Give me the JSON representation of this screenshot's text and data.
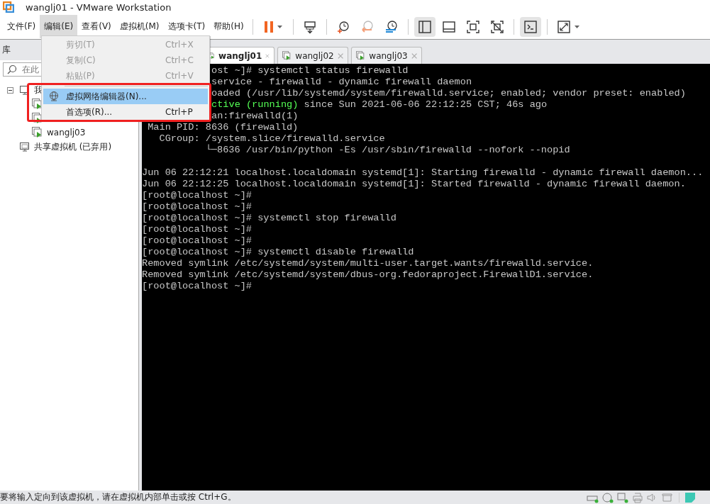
{
  "window": {
    "title": "wanglj01 - VMware Workstation"
  },
  "menubar": [
    {
      "label": "文件(F)",
      "selected": false
    },
    {
      "label": "编辑(E)",
      "selected": true
    },
    {
      "label": "查看(V)",
      "selected": false
    },
    {
      "label": "虚拟机(M)",
      "selected": false
    },
    {
      "label": "选项卡(T)",
      "selected": false
    },
    {
      "label": "帮助(H)",
      "selected": false
    }
  ],
  "toolbar": [
    {
      "kind": "sep"
    },
    {
      "kind": "pause",
      "on": false
    },
    {
      "kind": "sep"
    },
    {
      "kind": "sendkeys",
      "on": false
    },
    {
      "kind": "sep"
    },
    {
      "kind": "snapshot",
      "on": false
    },
    {
      "kind": "revert",
      "on": false
    },
    {
      "kind": "manage",
      "on": false
    },
    {
      "kind": "sep"
    },
    {
      "kind": "library",
      "on": true
    },
    {
      "kind": "thumbs",
      "on": false
    },
    {
      "kind": "fullscreen",
      "on": false
    },
    {
      "kind": "unity",
      "on": false
    },
    {
      "kind": "sep"
    },
    {
      "kind": "console",
      "on": true
    },
    {
      "kind": "sep"
    },
    {
      "kind": "stretch",
      "on": false
    }
  ],
  "library": {
    "title": "库",
    "search": {
      "placeholder": "在此"
    },
    "tree": [
      {
        "label": "我",
        "expanded": true,
        "kind": "computer",
        "children": [
          {
            "kind": "vm"
          },
          {
            "kind": "vm"
          },
          {
            "kind": "vm",
            "label": "wanglj03"
          }
        ]
      },
      {
        "label": "共享虚拟机 (已弃用)",
        "kind": "shared"
      }
    ]
  },
  "tabs": [
    {
      "label": "wanglj01",
      "selected": true
    },
    {
      "label": "wanglj02",
      "selected": false
    },
    {
      "label": "wanglj03",
      "selected": false
    }
  ],
  "edit_menu": {
    "items": [
      {
        "kind": "item",
        "label": "剪切(T)",
        "shortcut": "Ctrl+X",
        "disabled": true,
        "selected": false
      },
      {
        "kind": "item",
        "label": "复制(C)",
        "shortcut": "Ctrl+C",
        "disabled": true,
        "selected": false
      },
      {
        "kind": "item",
        "label": "粘贴(P)",
        "shortcut": "Ctrl+V",
        "disabled": true,
        "selected": false
      },
      {
        "kind": "separator"
      },
      {
        "kind": "globe",
        "label": "虚拟网络编辑器(N)...",
        "disabled": false,
        "selected": true
      },
      {
        "kind": "item",
        "label": "首选项(R)...",
        "shortcut": "Ctrl+P",
        "disabled": false,
        "selected": false
      }
    ]
  },
  "terminal": {
    "lines": [
      {
        "kind": "covered",
        "segments": [
          {
            "text": "ost ~]# systemctl status firewalld"
          }
        ]
      },
      {
        "kind": "covered",
        "segments": [
          {
            "text": "service - firewalld - dynamic firewall daemon"
          }
        ]
      },
      {
        "kind": "covered",
        "segments": [
          {
            "text": "oaded (/usr/lib/systemd/system/firewalld.service; enabled; vendor preset: enabled)"
          }
        ]
      },
      {
        "kind": "covered",
        "segments": [
          {
            "text": "ctive (running)",
            "color": "#55ff55"
          },
          {
            "text": " since Sun 2021-06-06 22:12:25 CST; 46s ago"
          }
        ]
      },
      {
        "kind": "covered",
        "segments": [
          {
            "text": "an:firewalld(1)"
          }
        ]
      },
      {
        "kind": "text",
        "segments": [
          {
            "text": " Main PID: 8636 (firewalld)"
          }
        ]
      },
      {
        "kind": "text",
        "segments": [
          {
            "text": "   CGroup: /system.slice/firewalld.service"
          }
        ]
      },
      {
        "kind": "text",
        "segments": [
          {
            "text": "           └─8636 /usr/bin/python -Es /usr/sbin/firewalld --nofork --nopid"
          }
        ]
      },
      {
        "kind": "blank"
      },
      {
        "kind": "text",
        "segments": [
          {
            "text": "Jun 06 22:12:21 localhost.localdomain systemd[1]: Starting firewalld - dynamic firewall daemon..."
          }
        ]
      },
      {
        "kind": "text",
        "segments": [
          {
            "text": "Jun 06 22:12:25 localhost.localdomain systemd[1]: Started firewalld - dynamic firewall daemon."
          }
        ]
      },
      {
        "kind": "text",
        "segments": [
          {
            "text": "[root@localhost ~]#"
          }
        ]
      },
      {
        "kind": "text",
        "segments": [
          {
            "text": "[root@localhost ~]#"
          }
        ]
      },
      {
        "kind": "text",
        "segments": [
          {
            "text": "[root@localhost ~]# systemctl stop firewalld"
          }
        ]
      },
      {
        "kind": "text",
        "segments": [
          {
            "text": "[root@localhost ~]#"
          }
        ]
      },
      {
        "kind": "text",
        "segments": [
          {
            "text": "[root@localhost ~]#"
          }
        ]
      },
      {
        "kind": "text",
        "segments": [
          {
            "text": "[root@localhost ~]# systemctl disable firewalld"
          }
        ]
      },
      {
        "kind": "text",
        "segments": [
          {
            "text": "Removed symlink /etc/systemd/system/multi-user.target.wants/firewalld.service."
          }
        ]
      },
      {
        "kind": "text",
        "segments": [
          {
            "text": "Removed symlink /etc/systemd/system/dbus-org.fedoraproject.FirewallD1.service."
          }
        ]
      },
      {
        "kind": "text",
        "segments": [
          {
            "text": "[root@localhost ~]#"
          }
        ]
      }
    ]
  },
  "status_bar": {
    "message": "要将输入定向到该虚拟机，请在虚拟机内部单击或按 Ctrl+G。",
    "devices": [
      {
        "kind": "disk",
        "active": true
      },
      {
        "kind": "cd",
        "active": true
      },
      {
        "kind": "net",
        "active": true
      },
      {
        "kind": "printer",
        "active": false
      },
      {
        "kind": "sound",
        "active": false
      },
      {
        "kind": "display",
        "active": false
      }
    ]
  }
}
